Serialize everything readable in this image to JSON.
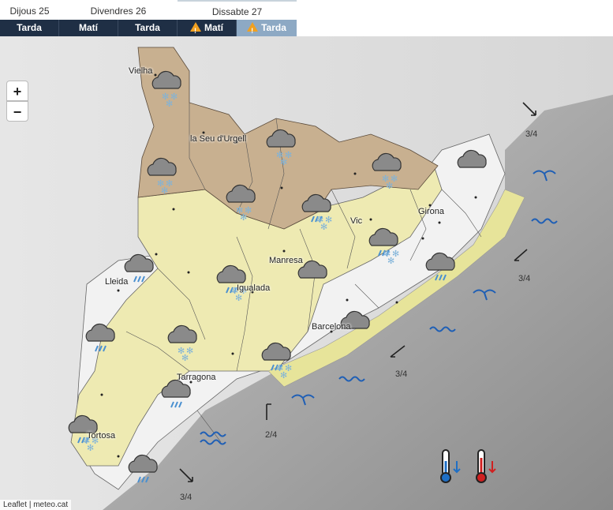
{
  "days": [
    "Dijous 25",
    "Divendres 26",
    "Dissabte 27"
  ],
  "periods": [
    {
      "label": "Tarda",
      "warn": false,
      "active": false
    },
    {
      "label": "Matí",
      "warn": false,
      "active": false
    },
    {
      "label": "Tarda",
      "warn": false,
      "active": false
    },
    {
      "label": "Matí",
      "warn": true,
      "active": false
    },
    {
      "label": "Tarda",
      "warn": true,
      "active": true
    }
  ],
  "zoom": {
    "in": "+",
    "out": "−"
  },
  "cities": {
    "vielha": "Vielha",
    "seu": "la Seu d'Urgell",
    "vic": "Vic",
    "girona": "Girona",
    "manresa": "Manresa",
    "lleida": "Lleida",
    "igualada": "Igualada",
    "barcelona": "Barcelona",
    "tarragona": "Tarragona",
    "tortosa": "Tortosa"
  },
  "sea_states": [
    "3/4",
    "3/4",
    "3/4",
    "2/4",
    "3/4"
  ],
  "attribution": {
    "leaflet": "Leaflet",
    "sep": "|",
    "source": "meteo.cat"
  },
  "colors": {
    "high_zone": "#c8b090",
    "mid_zone": "#eeeab2",
    "low_zone": "#f2f2f2",
    "coast_band": "#e7e49a",
    "sea": "#9a9a9a",
    "nav": "#1f2f45",
    "nav_active": "#8da9c4",
    "warning": "#f0a020"
  },
  "icons": [
    "snow-cloud-icon",
    "rain-cloud-icon",
    "cloud-icon",
    "rain-snow-cloud-icon",
    "thermometer-down-icon",
    "thermometer-up-icon",
    "wave-icon",
    "wind-arrow-icon"
  ]
}
